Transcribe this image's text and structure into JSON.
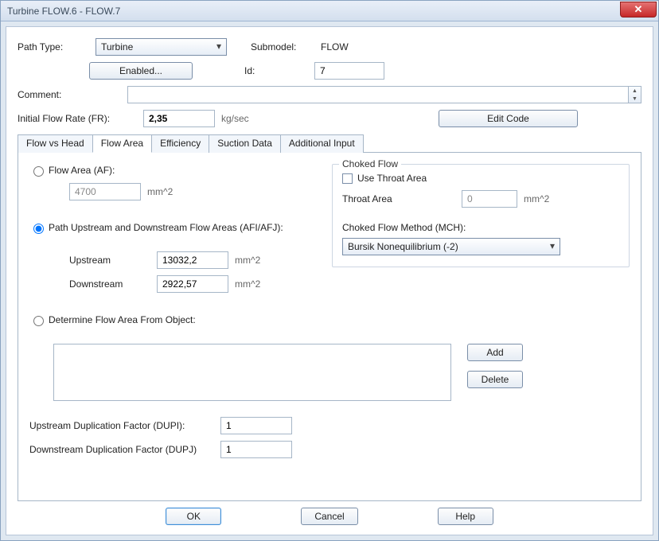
{
  "window_title": "Turbine FLOW.6 - FLOW.7",
  "close_glyph": "✕",
  "top": {
    "path_type_label": "Path Type:",
    "path_type_value": "Turbine",
    "submodel_label": "Submodel:",
    "submodel_value": "FLOW",
    "enabled_button": "Enabled...",
    "id_label": "Id:",
    "id_value": "7",
    "comment_label": "Comment:",
    "comment_value": "",
    "flow_rate_label": "Initial Flow Rate (FR):",
    "flow_rate_value": "2,35",
    "flow_rate_units": "kg/sec",
    "edit_code_button": "Edit Code"
  },
  "tabs": {
    "t0": "Flow vs Head",
    "t1": "Flow Area",
    "t2": "Efficiency",
    "t3": "Suction Data",
    "t4": "Additional Input",
    "active_index": 1
  },
  "flow_area": {
    "radio_af_label": "Flow Area (AF):",
    "af_value": "4700",
    "af_units": "mm^2",
    "radio_afiafj_label": "Path Upstream and Downstream Flow Areas (AFI/AFJ):",
    "upstream_label": "Upstream",
    "upstream_value": "13032,2",
    "upstream_units": "mm^2",
    "downstream_label": "Downstream",
    "downstream_value": "2922,57",
    "downstream_units": "mm^2",
    "radio_obj_label": "Determine Flow Area From Object:",
    "add_button": "Add",
    "delete_button": "Delete",
    "dupi_label": "Upstream Duplication Factor (DUPI):",
    "dupi_value": "1",
    "dupj_label": "Downstream Duplication Factor (DUPJ)",
    "dupj_value": "1"
  },
  "choked": {
    "legend": "Choked Flow",
    "use_throat_label": "Use Throat Area",
    "throat_label": "Throat Area",
    "throat_value": "0",
    "throat_units": "mm^2",
    "method_label": "Choked Flow Method (MCH):",
    "method_value": "Bursik Nonequilibrium (-2)"
  },
  "buttons": {
    "ok": "OK",
    "cancel": "Cancel",
    "help": "Help"
  },
  "spinner_up": "▲",
  "spinner_down": "▼"
}
